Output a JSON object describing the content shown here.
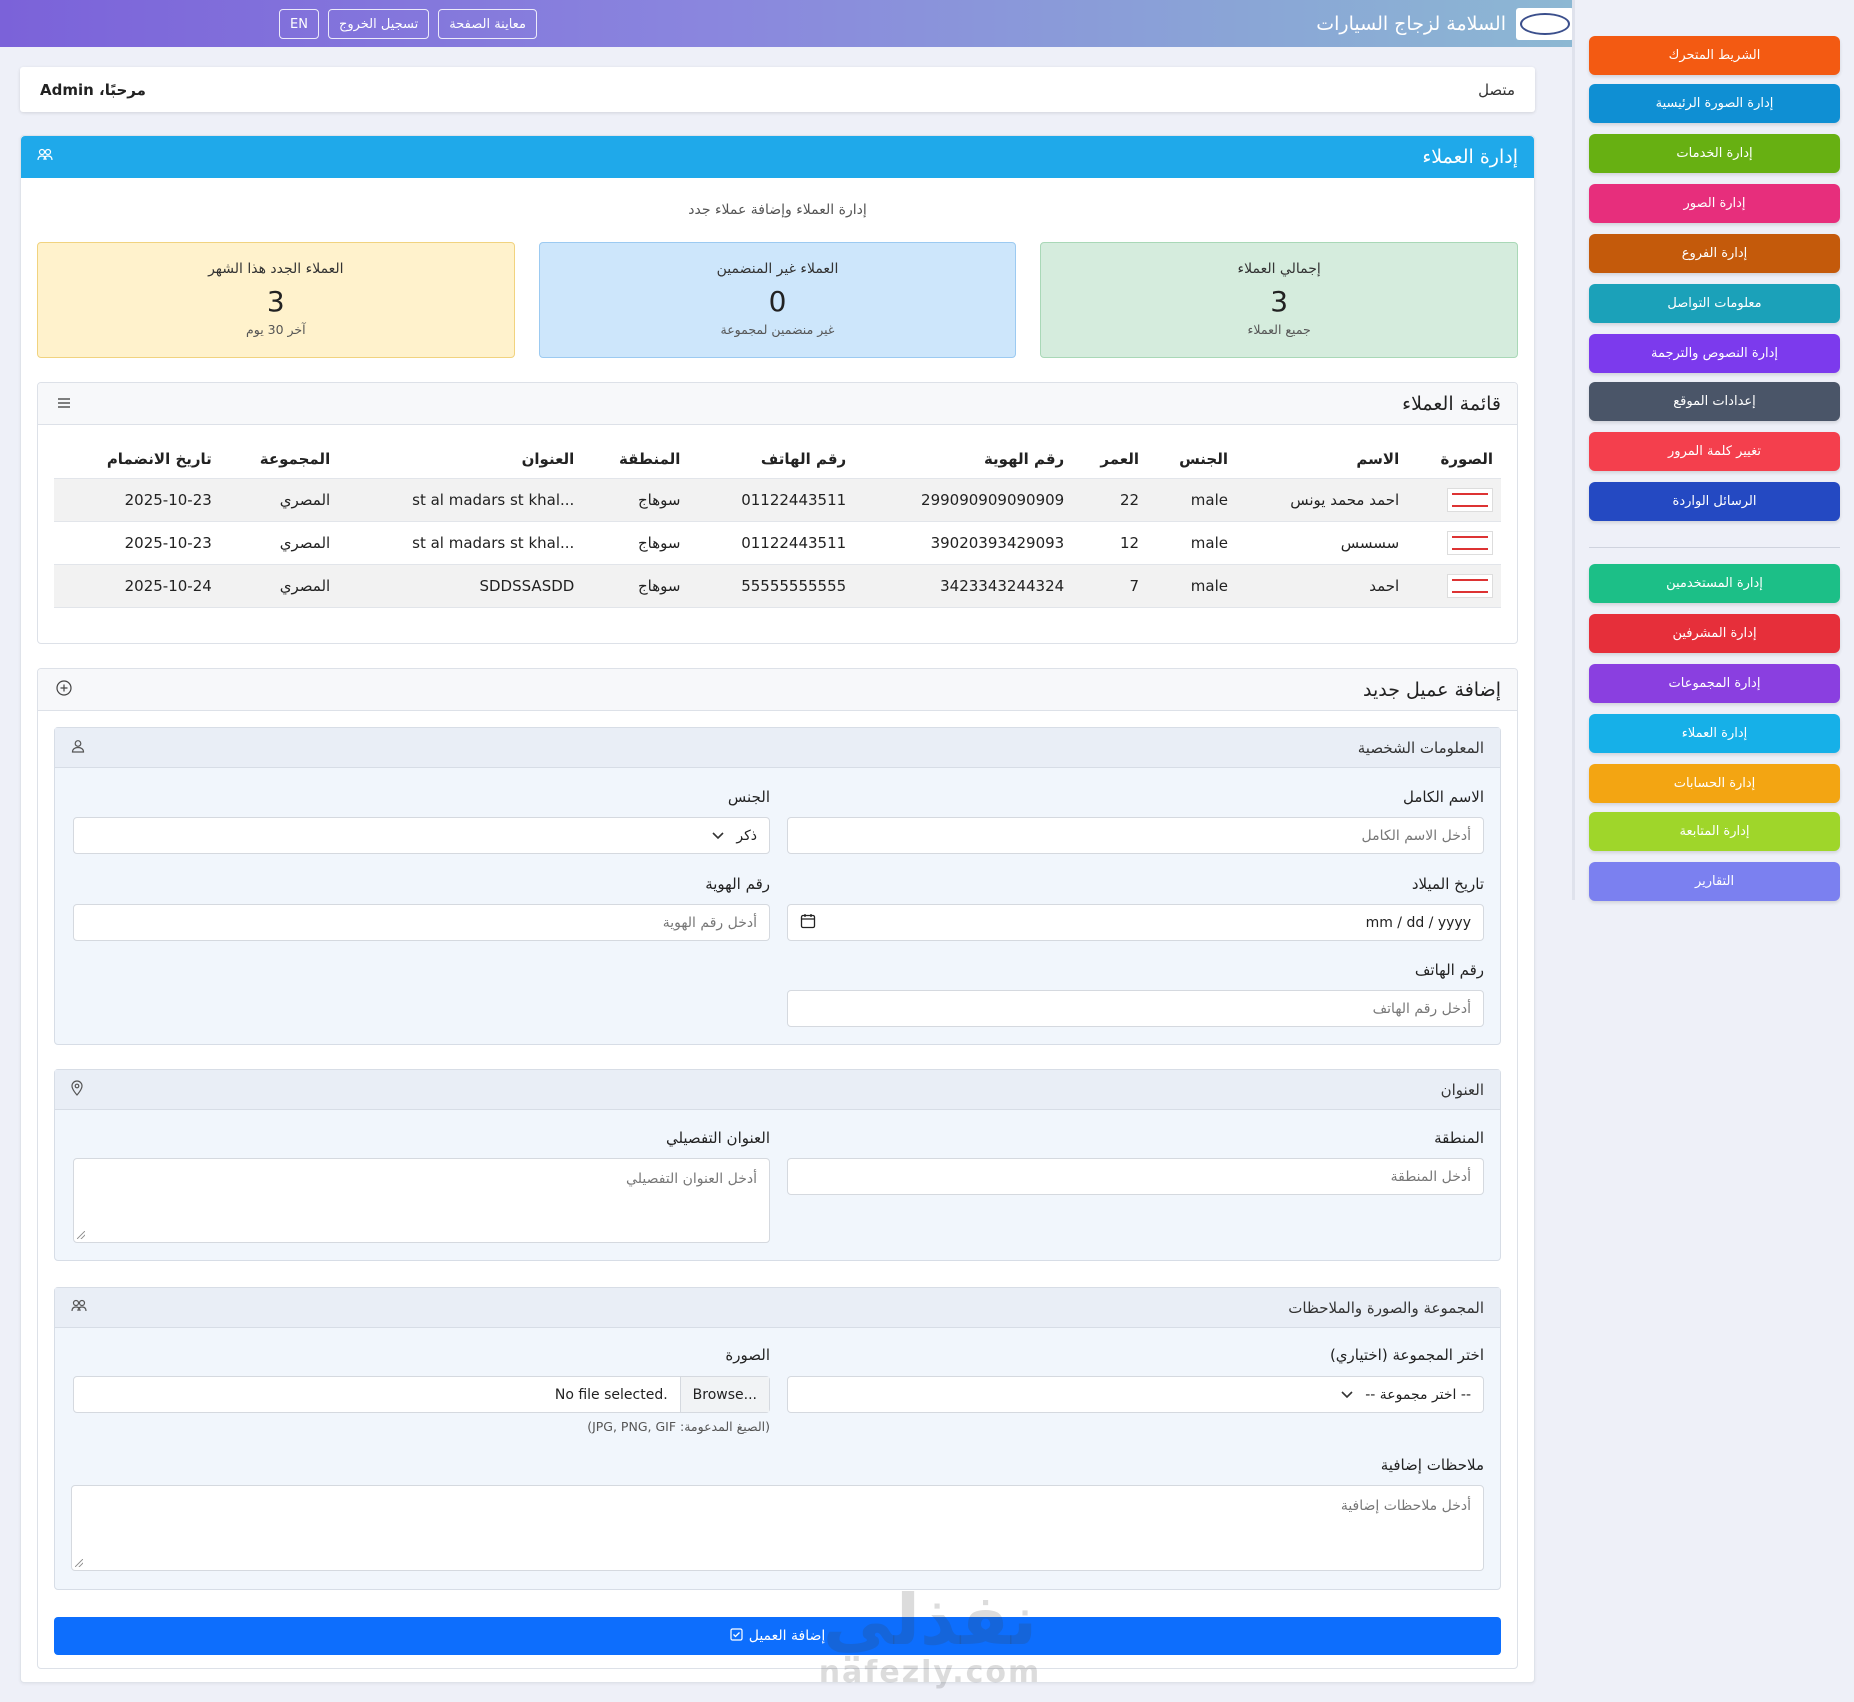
{
  "topbar": {
    "brand_title": "السلامة لزجاج السيارات",
    "lang_button": "EN",
    "logout_button": "تسجيل الخروج",
    "preview_button": "معاينة الصفحة"
  },
  "sidebar": {
    "items": [
      {
        "label": "الشريط المتحرك",
        "color": "#f35a12"
      },
      {
        "label": "إدارة الصورة الرئيسية",
        "color": "#0f8fd3"
      },
      {
        "label": "إدارة الخدمات",
        "color": "#67b012"
      },
      {
        "label": "إدارة الصور",
        "color": "#e72e7c"
      },
      {
        "label": "إدارة الفروع",
        "color": "#c45a0b"
      },
      {
        "label": "معلومات التواصل",
        "color": "#1ba1b9"
      },
      {
        "label": "إدارة النصوص والترجمة",
        "color": "#7c3aed"
      },
      {
        "label": "إعدادات الموقع",
        "color": "#4a5568"
      },
      {
        "label": "تغيير كلمة المرور",
        "color": "#f43f4d"
      },
      {
        "label": "الرسائل الواردة",
        "color": "#2449c2"
      },
      {
        "label": "إدارة المستخدمين",
        "color": "#1cbf87"
      },
      {
        "label": "إدارة المشرفين",
        "color": "#e62f3a"
      },
      {
        "label": "إدارة المجموعات",
        "color": "#8a3fe0"
      },
      {
        "label": "إدارة العملاء",
        "color": "#16b0e8"
      },
      {
        "label": "إدارة الحسابات",
        "color": "#f3a512"
      },
      {
        "label": "إدارة المتابعة",
        "color": "#9fd62a"
      },
      {
        "label": "التقارير",
        "color": "#7b80f0"
      }
    ]
  },
  "welcome": {
    "status": "متصل",
    "hello": "مرحبًا، Admin"
  },
  "main": {
    "title": "إدارة العملاء",
    "subtitle": "إدارة العملاء وإضافة عملاء جدد",
    "stats": [
      {
        "label": "إجمالي العملاء",
        "value": "3",
        "sub": "جميع العملاء"
      },
      {
        "label": "العملاء غير المنضمين",
        "value": "0",
        "sub": "غير منضمين لمجموعة"
      },
      {
        "label": "العملاء الجدد هذا الشهر",
        "value": "3",
        "sub": "آخر 30 يوم"
      }
    ]
  },
  "clients_list": {
    "title": "قائمة العملاء",
    "columns": [
      "الصورة",
      "الاسم",
      "الجنس",
      "العمر",
      "رقم الهوية",
      "رقم الهاتف",
      "المنطقة",
      "العنوان",
      "المجموعة",
      "تاريخ الانضمام"
    ],
    "rows": [
      {
        "name": "احمد محمد يونس",
        "gender": "male",
        "age": "22",
        "id": "299090909090909",
        "phone": "01122443511",
        "region": "سوهاج",
        "address": "st al madars st khal...",
        "group": "المصري",
        "joined": "2025-10-23"
      },
      {
        "name": "سسسس",
        "gender": "male",
        "age": "12",
        "id": "39020393429093",
        "phone": "01122443511",
        "region": "سوهاج",
        "address": "st al madars st khal...",
        "group": "المصري",
        "joined": "2025-10-23"
      },
      {
        "name": "احمد",
        "gender": "male",
        "age": "7",
        "id": "3423343244324",
        "phone": "55555555555",
        "region": "سوهاج",
        "address": "SDDSSASDD",
        "group": "المصري",
        "joined": "2025-10-24"
      }
    ]
  },
  "add_client": {
    "title": "إضافة عميل جديد",
    "personal": {
      "title": "المعلومات الشخصية",
      "fullname_label": "الاسم الكامل",
      "fullname_placeholder": "أدخل الاسم الكامل",
      "gender_label": "الجنس",
      "gender_value": "ذكر",
      "birth_label": "تاريخ الميلاد",
      "birth_value": "mm / dd / yyyy",
      "id_label": "رقم الهوية",
      "id_placeholder": "أدخل رقم الهوية",
      "phone_label": "رقم الهاتف",
      "phone_placeholder": "أدخل رقم الهاتف"
    },
    "address": {
      "title": "العنوان",
      "region_label": "المنطقة",
      "region_placeholder": "أدخل المنطقة",
      "detail_label": "العنوان التفصيلي",
      "detail_placeholder": "أدخل العنوان التفصيلي"
    },
    "group_section": {
      "title": "المجموعة والصورة والملاحظات",
      "group_label": "اختر المجموعة (اختياري)",
      "group_value": "-- اختر مجموعة --",
      "image_label": "الصورة",
      "browse_label": "Browse...",
      "file_status": "No file selected.",
      "formats_hint": "(الصيغ المدعومة: JPG, PNG, GIF)",
      "notes_label": "ملاحظات إضافية",
      "notes_placeholder": "أدخل ملاحظات إضافية"
    },
    "submit_label": "إضافة العميل"
  },
  "watermark": {
    "logo_text": "نفذلي",
    "domain": "nafezly.com"
  }
}
